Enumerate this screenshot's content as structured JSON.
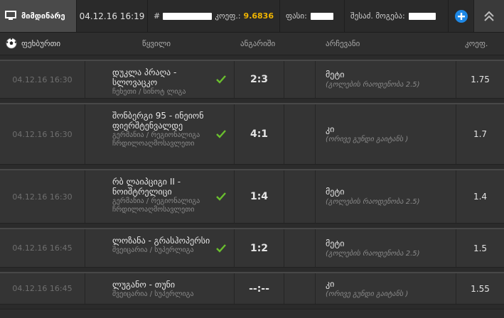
{
  "topbar": {
    "live_label": "მიმდინარე",
    "date": "04.12.16 16:19",
    "coupon_prefix": "#",
    "coupon_odds_label": "კოეფ.:",
    "coupon_odds_value": "9.6836",
    "price_label": "ფასი:",
    "win_label": "შესაძ. მოგება:"
  },
  "header": {
    "sport": "ფეხბურთი",
    "event": "წყვილი",
    "score": "ანგარიში",
    "pick": "არჩევანი",
    "odds": "კოეფ."
  },
  "rows": [
    {
      "time": "04.12.16 16:30",
      "teams": "დუკლა პრაღა - სლოვაცკო",
      "league": "ჩეხეთი / სინოტ ლიგა",
      "score": "2:3",
      "pick": "მეტი",
      "pick_sub": "(გოლების რაოდენობა 2.5)",
      "odds": "1.75"
    },
    {
      "time": "04.12.16 16:30",
      "teams": "შონბერგი 95 - ინეიონ ფიერშტენვალდე",
      "league": "გერმანია / რეგიონალიგა ჩრდილოაღმოსავლეთი",
      "score": "4:1",
      "pick": "კი",
      "pick_sub": "(ორივე გუნდი გაიტანს )",
      "odds": "1.7"
    },
    {
      "time": "04.12.16 16:30",
      "teams": "რბ ლაიპციგი II - ნოიშტრელიცი",
      "league": "გერმანია / რეგიონალიგა ჩრდილოაღმოსავლეთი",
      "score": "1:4",
      "pick": "მეტი",
      "pick_sub": "(გოლების რაოდენობა 2.5)",
      "odds": "1.4"
    },
    {
      "time": "04.12.16 16:45",
      "teams": "ლოზანა - გრასჰოპერსი",
      "league": "შვეიცარია / სუპერლიგა",
      "score": "1:2",
      "pick": "მეტი",
      "pick_sub": "(გოლების რაოდენობა 2.5)",
      "odds": "1.5"
    },
    {
      "time": "04.12.16 16:45",
      "teams": "ლუგანო - თუნი",
      "league": "შვეიცარია / სუპერლიგა",
      "score": "--:--",
      "pick": "კი",
      "pick_sub": "(ორივე გუნდი გაიტანს )",
      "odds": "1.55"
    }
  ],
  "colors": {
    "accent_odds": "#f0b400",
    "check_green": "#6abf2e",
    "add_blue": "#1e88e5"
  }
}
